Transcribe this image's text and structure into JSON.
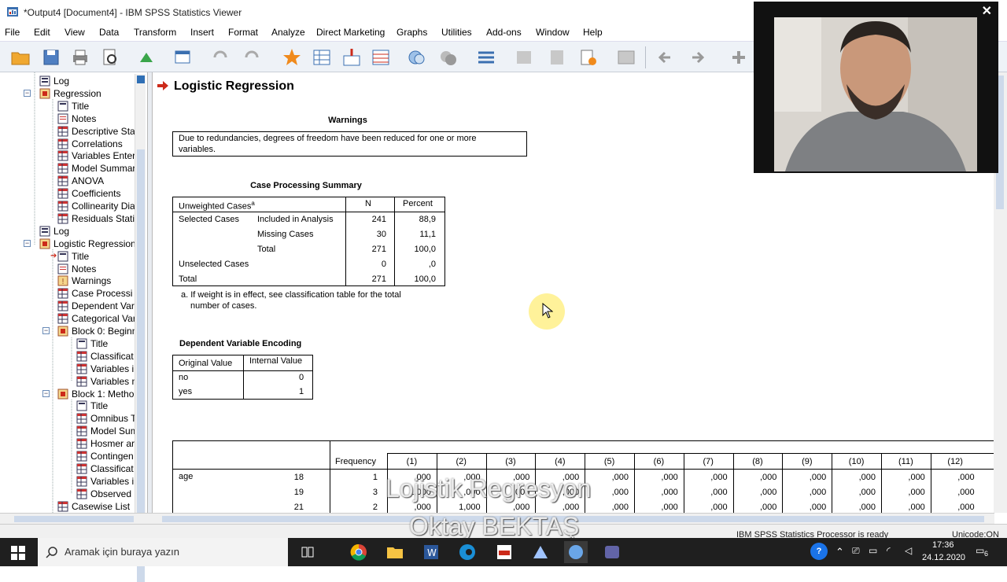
{
  "window": {
    "title": "*Output4 [Document4] - IBM SPSS Statistics Viewer"
  },
  "menu": [
    "File",
    "Edit",
    "View",
    "Data",
    "Transform",
    "Insert",
    "Format",
    "Analyze",
    "Direct Marketing",
    "Graphs",
    "Utilities",
    "Add-ons",
    "Window",
    "Help"
  ],
  "outline": [
    {
      "label": "Log",
      "icon": "log-icon"
    },
    {
      "label": "Regression",
      "icon": "book-icon"
    },
    {
      "label": "Title",
      "icon": "title-icon"
    },
    {
      "label": "Notes",
      "icon": "notes-icon"
    },
    {
      "label": "Descriptive Stat",
      "icon": "table-icon"
    },
    {
      "label": "Correlations",
      "icon": "table-icon"
    },
    {
      "label": "Variables Enter",
      "icon": "table-icon"
    },
    {
      "label": "Model Summar",
      "icon": "table-icon"
    },
    {
      "label": "ANOVA",
      "icon": "table-icon"
    },
    {
      "label": "Coefficients",
      "icon": "table-icon"
    },
    {
      "label": "Collinearity Dia",
      "icon": "table-icon"
    },
    {
      "label": "Residuals Stati",
      "icon": "table-icon"
    },
    {
      "label": "Log",
      "icon": "log-icon"
    },
    {
      "label": "Logistic Regression",
      "icon": "book-icon"
    },
    {
      "label": "Title",
      "icon": "title-icon"
    },
    {
      "label": "Notes",
      "icon": "notes-icon"
    },
    {
      "label": "Warnings",
      "icon": "warning-icon"
    },
    {
      "label": "Case Processi",
      "icon": "table-icon"
    },
    {
      "label": "Dependent Var",
      "icon": "table-icon"
    },
    {
      "label": "Categorical Var",
      "icon": "table-icon"
    },
    {
      "label": "Block 0: Beginn",
      "icon": "book-icon"
    },
    {
      "label": "Title",
      "icon": "title-icon"
    },
    {
      "label": "Classificat",
      "icon": "table-icon"
    },
    {
      "label": "Variables i",
      "icon": "table-icon"
    },
    {
      "label": "Variables n",
      "icon": "table-icon"
    },
    {
      "label": "Block 1: Metho",
      "icon": "book-icon"
    },
    {
      "label": "Title",
      "icon": "title-icon"
    },
    {
      "label": "Omnibus T",
      "icon": "table-icon"
    },
    {
      "label": "Model Sum",
      "icon": "table-icon"
    },
    {
      "label": "Hosmer ar",
      "icon": "table-icon"
    },
    {
      "label": "Contingen",
      "icon": "table-icon"
    },
    {
      "label": "Classificat",
      "icon": "table-icon"
    },
    {
      "label": "Variables i",
      "icon": "table-icon"
    },
    {
      "label": "Observed",
      "icon": "table-icon"
    },
    {
      "label": "Casewise List",
      "icon": "table-icon"
    }
  ],
  "content": {
    "heading": "Logistic Regression",
    "warnings": {
      "title": "Warnings",
      "text1": "Due to redundancies, degrees of freedom have been reduced for one or more",
      "text2": "variables."
    },
    "case_summary": {
      "title": "Case Processing Summary",
      "h1": "Unweighted Cases",
      "h1_sup": "a",
      "h2": "N",
      "h3": "Percent",
      "rows": [
        {
          "a": "Selected Cases",
          "b": "Included in Analysis",
          "n": "241",
          "p": "88,9"
        },
        {
          "a": "",
          "b": "Missing Cases",
          "n": "30",
          "p": "11,1"
        },
        {
          "a": "",
          "b": "Total",
          "n": "271",
          "p": "100,0"
        },
        {
          "a": "Unselected Cases",
          "b": "",
          "n": "0",
          "p": ",0"
        },
        {
          "a": "Total",
          "b": "",
          "n": "271",
          "p": "100,0"
        }
      ],
      "foot1": "a. If weight is in effect, see classification table for the total",
      "foot2": "number of cases."
    },
    "dep_encoding": {
      "title": "Dependent Variable Encoding",
      "h1": "Original Value",
      "h2": "Internal Value",
      "rows": [
        {
          "a": "no",
          "b": "0"
        },
        {
          "a": "yes",
          "b": "1"
        }
      ]
    },
    "codings": {
      "freq_header": "Frequency",
      "cols": [
        "(1)",
        "(2)",
        "(3)",
        "(4)",
        "(5)",
        "(6)",
        "(7)",
        "(8)",
        "(9)",
        "(10)",
        "(11)",
        "(12)"
      ],
      "var": "age",
      "rows": [
        {
          "v": "18",
          "f": "1",
          "vals": [
            ",000",
            ",000",
            ",000",
            ",000",
            ",000",
            ",000",
            ",000",
            ",000",
            ",000",
            ",000",
            ",000",
            ",000"
          ]
        },
        {
          "v": "19",
          "f": "3",
          "vals": [
            "1,000",
            ",000",
            ",000",
            ",000",
            ",000",
            ",000",
            ",000",
            ",000",
            ",000",
            ",000",
            ",000",
            ",000"
          ]
        },
        {
          "v": "21",
          "f": "2",
          "vals": [
            ",000",
            "1,000",
            ",000",
            ",000",
            ",000",
            ",000",
            ",000",
            ",000",
            ",000",
            ",000",
            ",000",
            ",000"
          ]
        }
      ]
    }
  },
  "status": {
    "processor": "IBM SPSS Statistics Processor is ready",
    "unicode": "Unicode:ON"
  },
  "taskbar": {
    "search_placeholder": "Aramak için buraya yazın",
    "time": "17:36",
    "date": "24.12.2020",
    "notif_count": "6"
  },
  "watermark": {
    "line1": "Lojistik Regresyon",
    "line2": "Oktay BEKTAŞ"
  },
  "colors": {
    "spss_red": "#cc2a1a",
    "toolbar_bg": "#eef2f7",
    "taskbar": "#1f1f1f"
  }
}
